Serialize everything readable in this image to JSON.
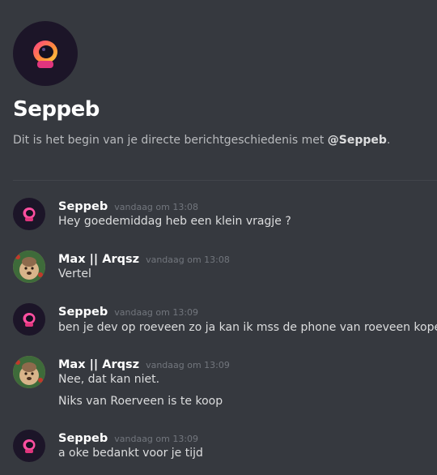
{
  "header": {
    "title": "Seppeb",
    "intro_prefix": "Dit is het begin van je directe berichtgeschiedenis met ",
    "intro_mention": "@Seppeb",
    "intro_suffix": "."
  },
  "messages": [
    {
      "author": "Seppeb",
      "timestamp": "vandaag om 13:08",
      "lines": [
        "Hey goedemiddag heb een klein vragje ?"
      ],
      "avatar": "seppeb-avatar"
    },
    {
      "author": "Max || Arqsz",
      "timestamp": "vandaag om 13:08",
      "lines": [
        "Vertel"
      ],
      "avatar": "max-avatar"
    },
    {
      "author": "Seppeb",
      "timestamp": "vandaag om 13:09",
      "lines": [
        "ben je dev op roeveen zo ja kan ik mss de phone van roeveen kopen ?"
      ],
      "avatar": "seppeb-avatar"
    },
    {
      "author": "Max || Arqsz",
      "timestamp": "vandaag om 13:09",
      "lines": [
        "Nee, dat kan niet.",
        "Niks van Roerveen is te koop"
      ],
      "avatar": "max-avatar"
    },
    {
      "author": "Seppeb",
      "timestamp": "vandaag om 13:09",
      "lines": [
        "a oke bedankt voor je tijd"
      ],
      "avatar": "seppeb-avatar"
    }
  ],
  "colors": {
    "background": "#36393f",
    "username": "#ffffff",
    "timestamp": "#72767d",
    "text": "#dcddde"
  }
}
